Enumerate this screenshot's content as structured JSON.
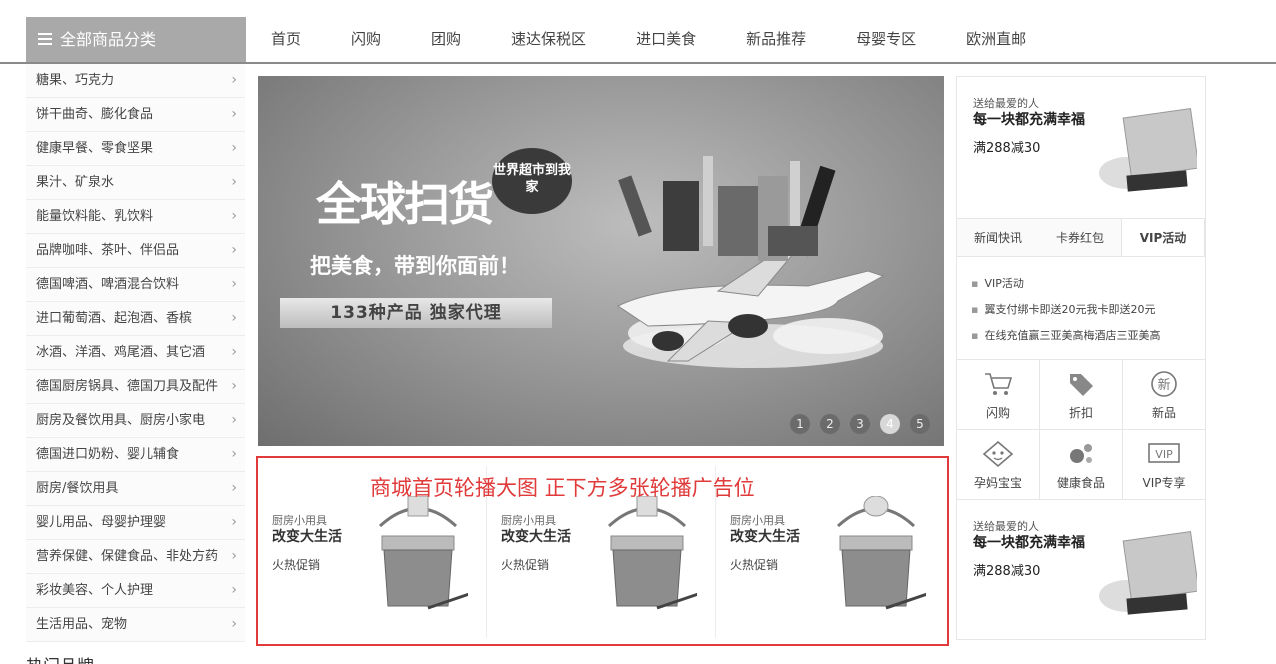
{
  "topnav": {
    "category_title": "全部商品分类",
    "items": [
      "首页",
      "闪购",
      "团购",
      "速达保税区",
      "进口美食",
      "新品推荐",
      "母婴专区",
      "欧洲直邮"
    ]
  },
  "sidebar": {
    "items": [
      "糖果、巧克力",
      "饼干曲奇、膨化食品",
      "健康早餐、零食坚果",
      "果汁、矿泉水",
      "能量饮料能、乳饮料",
      "品牌咖啡、茶叶、伴侣品",
      "德国啤酒、啤酒混合饮料",
      "进口葡萄酒、起泡酒、香槟",
      "冰酒、洋酒、鸡尾酒、其它酒",
      "德国厨房锅具、德国刀具及配件",
      "厨房及餐饮用具、厨房小家电",
      "德国进口奶粉、婴儿辅食",
      "厨房/餐饮用具",
      "婴儿用品、母婴护理婴",
      "营养保健、保健食品、非处方药",
      "彩妆美容、个人护理",
      "生活用品、宠物"
    ]
  },
  "banner": {
    "headline": "全球扫货",
    "bubble": "世界超市到我家",
    "sub": "把美食，带到你面前！",
    "ribbon": "133种产品 独家代理",
    "pages": [
      "1",
      "2",
      "3",
      "4",
      "5"
    ],
    "active_page": "4"
  },
  "adstrip": {
    "annotation": "商城首页轮播大图 正下方多张轮播广告位",
    "cards": [
      {
        "t1": "厨房小用具",
        "t2": "改变大生活",
        "t3": "火热促销"
      },
      {
        "t1": "厨房小用具",
        "t2": "改变大生活",
        "t3": "火热促销"
      },
      {
        "t1": "厨房小用具",
        "t2": "改变大生活",
        "t3": "火热促销"
      }
    ]
  },
  "rightcol": {
    "promo": {
      "p1": "送给最爱的人",
      "p2": "每一块都充满幸福",
      "p3": "满288减30"
    },
    "tabs": [
      "新闻快讯",
      "卡券红包",
      "VIP活动"
    ],
    "active_tab": "VIP活动",
    "news": [
      "VIP活动",
      "翼支付绑卡即送20元我卡即送20元",
      "在线充值赢三亚美高梅酒店三亚美高"
    ],
    "icons": [
      {
        "label": "闪购",
        "icon": "cart-icon"
      },
      {
        "label": "折扣",
        "icon": "tag-icon"
      },
      {
        "label": "新品",
        "icon": "new-badge-icon",
        "glyph": "新"
      },
      {
        "label": "孕妈宝宝",
        "icon": "baby-icon"
      },
      {
        "label": "健康食品",
        "icon": "health-food-icon"
      },
      {
        "label": "VIP专享",
        "icon": "vip-icon",
        "glyph": "VIP"
      }
    ]
  },
  "bottom": {
    "title": "热门品牌"
  }
}
